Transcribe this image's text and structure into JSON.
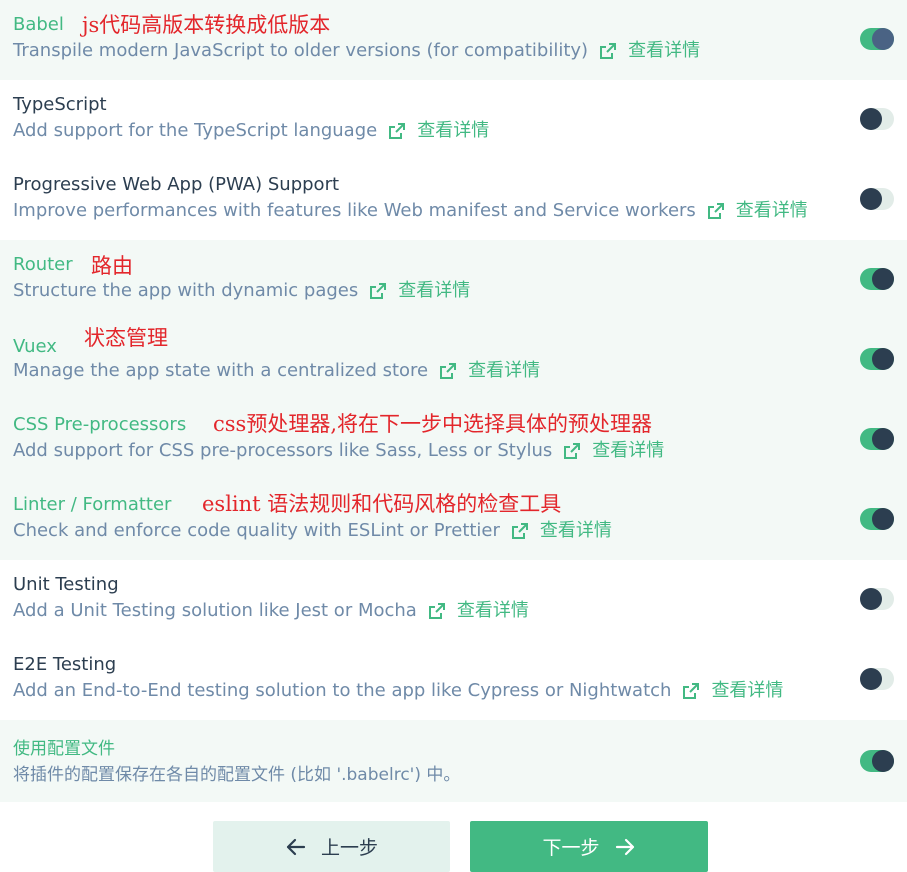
{
  "more_label": "查看详情",
  "colors": {
    "accent": "#42b983",
    "title": "#2c3e50",
    "description": "#6f8aa8",
    "annotation": "#e3262b",
    "selected_row_bg": "#f3f9f6"
  },
  "features": [
    {
      "title": "Babel",
      "note": "js代码高版本转换成低版本",
      "description": "Transpile modern JavaScript to older versions (for compatibility)",
      "enabled": true
    },
    {
      "title": "TypeScript",
      "note": "",
      "description": "Add support for the TypeScript language",
      "enabled": false
    },
    {
      "title": "Progressive Web App (PWA) Support",
      "note": "",
      "description": "Improve performances with features like Web manifest and Service workers",
      "enabled": false
    },
    {
      "title": "Router",
      "note": "路由",
      "description": "Structure the app with dynamic pages",
      "enabled": true
    },
    {
      "title": "Vuex",
      "note": "状态管理",
      "description": "Manage the app state with a centralized store",
      "enabled": true
    },
    {
      "title": "CSS Pre-processors",
      "note": "css预处理器,将在下一步中选择具体的预处理器",
      "description": "Add support for CSS pre-processors like Sass, Less or Stylus",
      "enabled": true
    },
    {
      "title": "Linter / Formatter",
      "note": "eslint 语法规则和代码风格的检查工具",
      "description": "Check and enforce code quality with ESLint or Prettier",
      "enabled": true
    },
    {
      "title": "Unit Testing",
      "note": "",
      "description": "Add a Unit Testing solution like Jest or Mocha",
      "enabled": false
    },
    {
      "title": "E2E Testing",
      "note": "",
      "description": "Add an End-to-End testing solution to the app like Cypress or Nightwatch",
      "enabled": false
    }
  ],
  "config_files": {
    "title": "使用配置文件",
    "description": "将插件的配置保存在各自的配置文件 (比如 '.babelrc') 中。",
    "enabled": true
  },
  "footer": {
    "prev_label": "上一步",
    "next_label": "下一步",
    "prev_icon": "arrow-left-icon",
    "next_icon": "arrow-right-icon"
  }
}
